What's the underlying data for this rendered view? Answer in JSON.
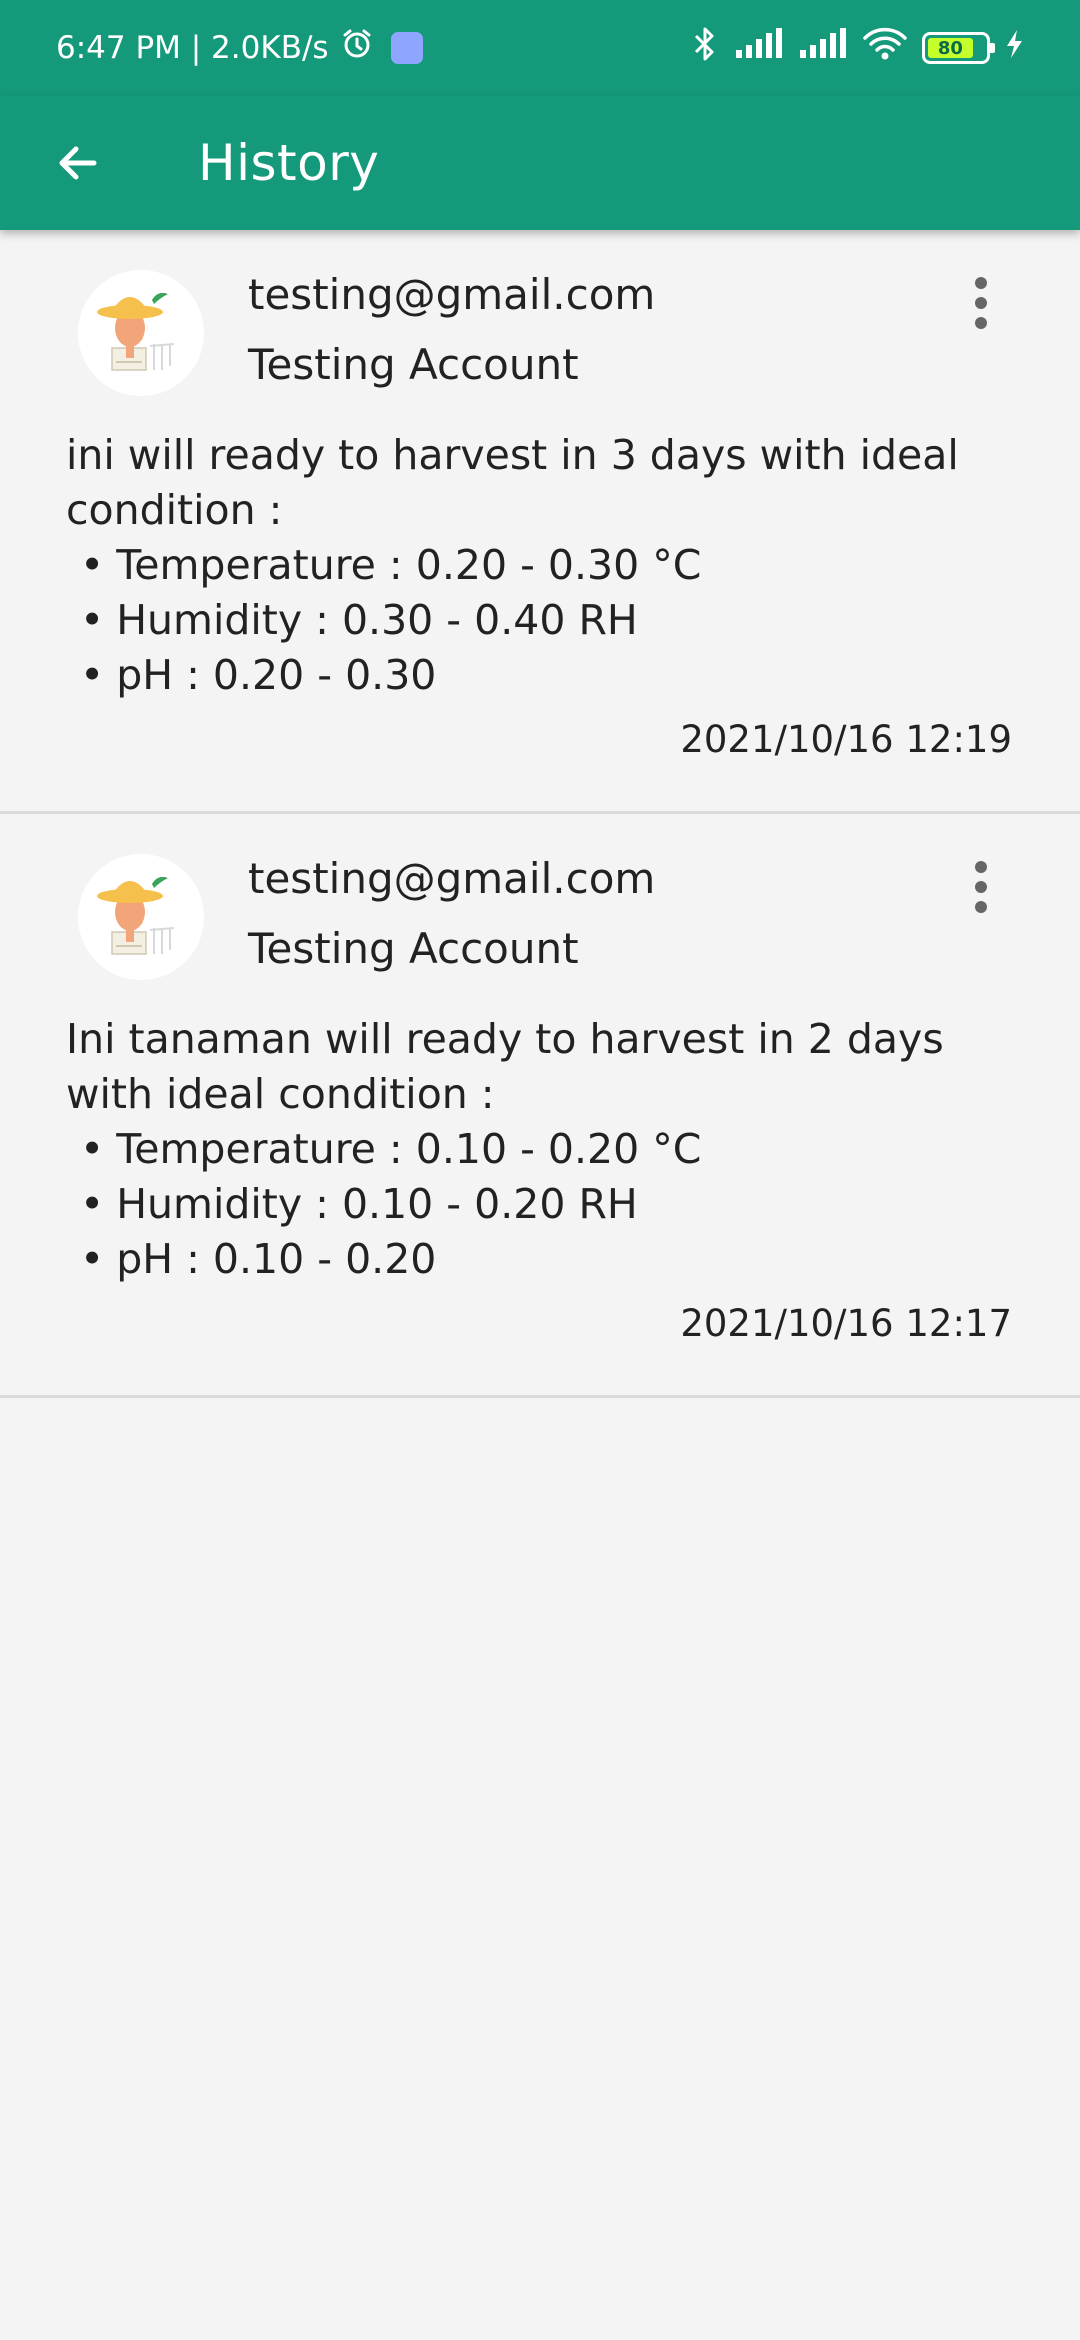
{
  "status_bar": {
    "time_speed": "6:47 PM | 2.0KB/s",
    "battery_percent": "80",
    "icons": [
      "alarm-icon",
      "app-notification-icon",
      "bluetooth-icon",
      "signal-icon",
      "signal-icon",
      "wifi-icon",
      "battery-icon",
      "charging-icon"
    ]
  },
  "appbar": {
    "title": "History",
    "back_icon": "arrow-back-icon",
    "color": "#14997a"
  },
  "history": [
    {
      "email": "testing@gmail.com",
      "account": "Testing Account",
      "intro": "ini will ready to harvest in 3 days with ideal condition :",
      "bullets": [
        "Temperature : 0.20 - 0.30 °C",
        "Humidity : 0.30 - 0.40 RH",
        "pH : 0.20 - 0.30"
      ],
      "timestamp": "2021/10/16 12:19"
    },
    {
      "email": "testing@gmail.com",
      "account": "Testing Account",
      "intro": "Ini tanaman will ready to harvest in 2 days with ideal condition :",
      "bullets": [
        "Temperature : 0.10 - 0.20 °C",
        "Humidity : 0.10 - 0.20 RH",
        "pH : 0.10 - 0.20"
      ],
      "timestamp": "2021/10/16 12:17"
    }
  ]
}
